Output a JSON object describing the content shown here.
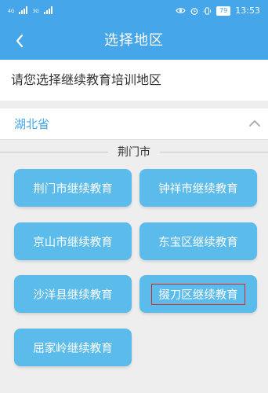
{
  "status_bar": {
    "left_indicators": [
      "4G",
      "3G"
    ],
    "battery": "79",
    "time": "13:53"
  },
  "header": {
    "back_icon": "chevron-left-icon",
    "title": "选择地区"
  },
  "prompt": "请您选择继续教育培训地区",
  "province": {
    "name": "湖北省",
    "toggle_icon": "chevron-up-icon"
  },
  "city": {
    "name": "荆门市",
    "items": [
      {
        "label": "荆门市继续教育"
      },
      {
        "label": "钟祥市继续教育"
      },
      {
        "label": "京山市继续教育"
      },
      {
        "label": "东宝区继续教育"
      },
      {
        "label": "沙洋县继续教育"
      },
      {
        "label": "掇刀区继续教育",
        "highlighted": true
      },
      {
        "label": "屈家岭继续教育"
      }
    ]
  },
  "colors": {
    "brand": "#45a6ea",
    "tile": "#5bbbea",
    "highlight_box": "#d62a2a"
  }
}
